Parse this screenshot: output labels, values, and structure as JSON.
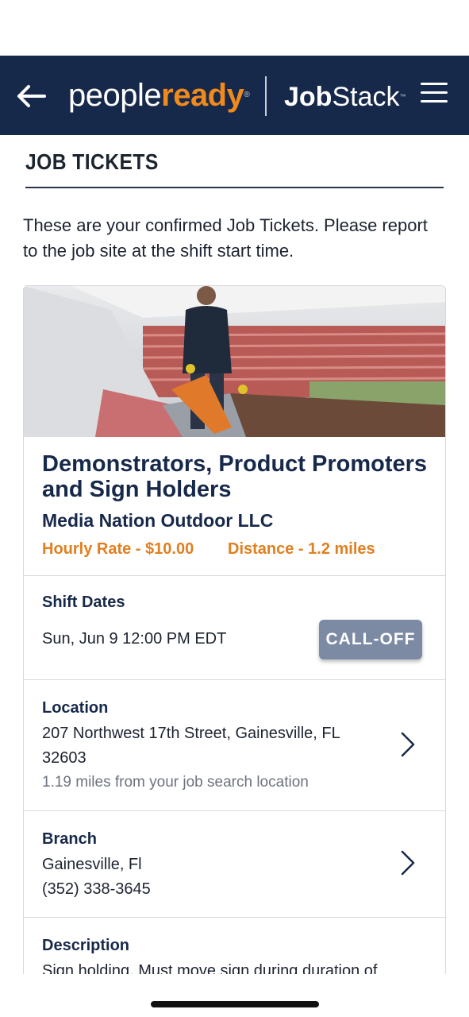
{
  "header": {
    "brand_part1": "people",
    "brand_part2": "ready",
    "trademark": "®",
    "app_name_bold": "Job",
    "app_name_light": "Stack",
    "app_tm": "™"
  },
  "page": {
    "title": "JOB TICKETS",
    "intro": "These are your confirmed Job Tickets. Please report to the job site at the shift start time."
  },
  "ticket": {
    "job_title": "Demonstrators, Product Promoters and Sign Holders",
    "company": "Media Nation Outdoor LLC",
    "hourly_rate": "Hourly Rate - $10.00",
    "distance": "Distance - 1.2 miles",
    "shift": {
      "label": "Shift Dates",
      "date": "Sun, Jun 9 12:00 PM EDT",
      "calloff_label": "CALL-OFF"
    },
    "location": {
      "label": "Location",
      "address_line1": "207 Northwest 17th Street, Gainesville, FL",
      "address_line2": "32603",
      "distance_note": "1.19 miles from your job search location"
    },
    "branch": {
      "label": "Branch",
      "city": "Gainesville, Fl",
      "phone": "(352) 338-3645"
    },
    "description": {
      "label": "Description",
      "text": "Sign holding. Must move sign during duration of"
    }
  },
  "colors": {
    "header_bg": "#17294a",
    "accent_orange": "#e07f1f",
    "button_gray": "#7c8aa4"
  },
  "icons": [
    "back-arrow-icon",
    "hamburger-menu-icon",
    "chevron-right-icon"
  ]
}
